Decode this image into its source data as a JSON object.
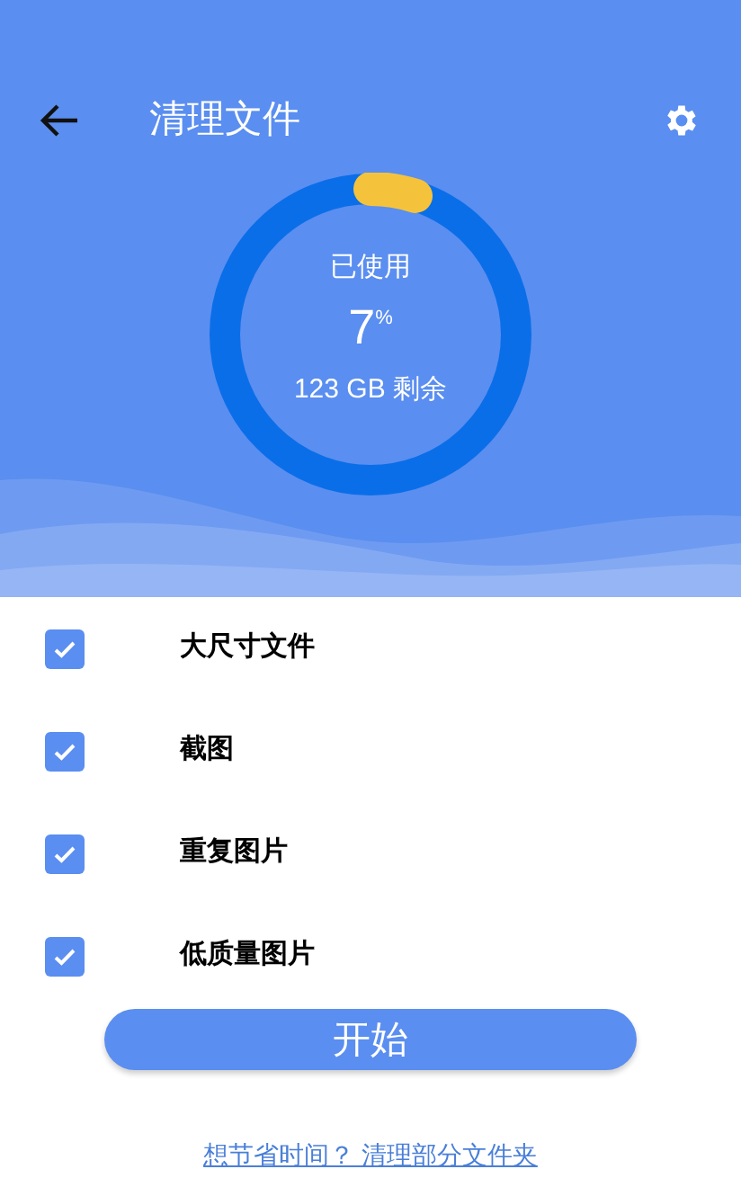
{
  "header": {
    "title": "清理文件"
  },
  "storage": {
    "label": "已使用",
    "value": "7",
    "unit": "%",
    "remaining": "123 GB 剩余"
  },
  "options": [
    {
      "label": "大尺寸文件",
      "checked": true
    },
    {
      "label": "截图",
      "checked": true
    },
    {
      "label": "重复图片",
      "checked": true
    },
    {
      "label": "低质量图片",
      "checked": true
    }
  ],
  "start_button": "开始",
  "link": "想节省时间？ 清理部分文件夹"
}
